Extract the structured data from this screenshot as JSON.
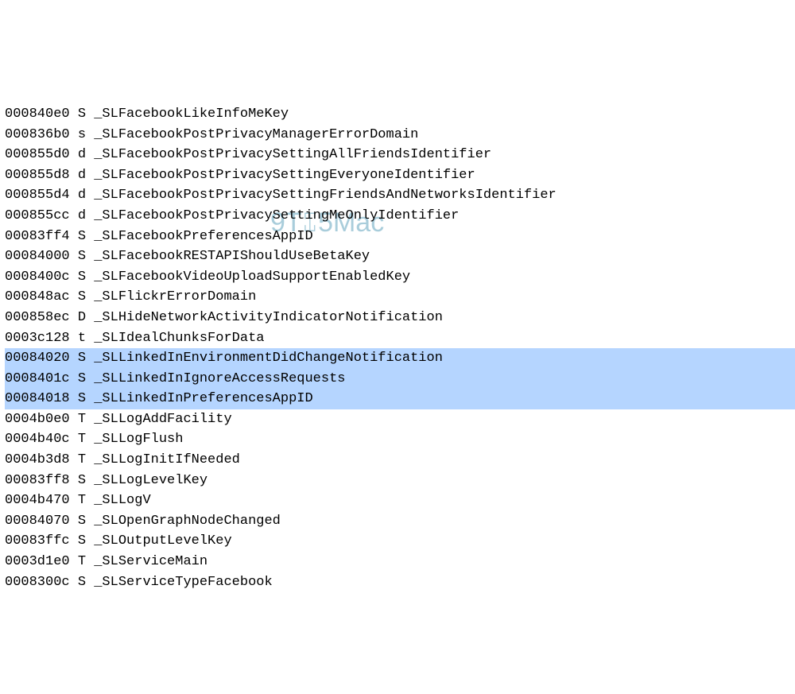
{
  "watermark": "9T⑄5Mac",
  "lines": [
    {
      "addr": "000840e0",
      "type": "S",
      "symbol": "_SLFacebookLikeInfoMeKey",
      "highlighted": false
    },
    {
      "addr": "000836b0",
      "type": "s",
      "symbol": "_SLFacebookPostPrivacyManagerErrorDomain",
      "highlighted": false
    },
    {
      "addr": "000855d0",
      "type": "d",
      "symbol": "_SLFacebookPostPrivacySettingAllFriendsIdentifier",
      "highlighted": false
    },
    {
      "addr": "000855d8",
      "type": "d",
      "symbol": "_SLFacebookPostPrivacySettingEveryoneIdentifier",
      "highlighted": false
    },
    {
      "addr": "000855d4",
      "type": "d",
      "symbol": "_SLFacebookPostPrivacySettingFriendsAndNetworksIdentifier",
      "highlighted": false
    },
    {
      "addr": "000855cc",
      "type": "d",
      "symbol": "_SLFacebookPostPrivacySettingMeOnlyIdentifier",
      "highlighted": false
    },
    {
      "addr": "00083ff4",
      "type": "S",
      "symbol": "_SLFacebookPreferencesAppID",
      "highlighted": false
    },
    {
      "addr": "00084000",
      "type": "S",
      "symbol": "_SLFacebookRESTAPIShouldUseBetaKey",
      "highlighted": false
    },
    {
      "addr": "0008400c",
      "type": "S",
      "symbol": "_SLFacebookVideoUploadSupportEnabledKey",
      "highlighted": false
    },
    {
      "addr": "000848ac",
      "type": "S",
      "symbol": "_SLFlickrErrorDomain",
      "highlighted": false
    },
    {
      "addr": "000858ec",
      "type": "D",
      "symbol": "_SLHideNetworkActivityIndicatorNotification",
      "highlighted": false
    },
    {
      "addr": "0003c128",
      "type": "t",
      "symbol": "_SLIdealChunksForData",
      "highlighted": false
    },
    {
      "addr": "00084020",
      "type": "S",
      "symbol": "_SLLinkedInEnvironmentDidChangeNotification",
      "highlighted": true
    },
    {
      "addr": "0008401c",
      "type": "S",
      "symbol": "_SLLinkedInIgnoreAccessRequests",
      "highlighted": true
    },
    {
      "addr": "00084018",
      "type": "S",
      "symbol": "_SLLinkedInPreferencesAppID",
      "highlighted": true
    },
    {
      "addr": "0004b0e0",
      "type": "T",
      "symbol": "_SLLogAddFacility",
      "highlighted": false
    },
    {
      "addr": "0004b40c",
      "type": "T",
      "symbol": "_SLLogFlush",
      "highlighted": false
    },
    {
      "addr": "0004b3d8",
      "type": "T",
      "symbol": "_SLLogInitIfNeeded",
      "highlighted": false
    },
    {
      "addr": "00083ff8",
      "type": "S",
      "symbol": "_SLLogLevelKey",
      "highlighted": false
    },
    {
      "addr": "0004b470",
      "type": "T",
      "symbol": "_SLLogV",
      "highlighted": false
    },
    {
      "addr": "00084070",
      "type": "S",
      "symbol": "_SLOpenGraphNodeChanged",
      "highlighted": false
    },
    {
      "addr": "00083ffc",
      "type": "S",
      "symbol": "_SLOutputLevelKey",
      "highlighted": false
    },
    {
      "addr": "0003d1e0",
      "type": "T",
      "symbol": "_SLServiceMain",
      "highlighted": false
    },
    {
      "addr": "0008300c",
      "type": "S",
      "symbol": "_SLServiceTypeFacebook",
      "highlighted": false
    }
  ]
}
